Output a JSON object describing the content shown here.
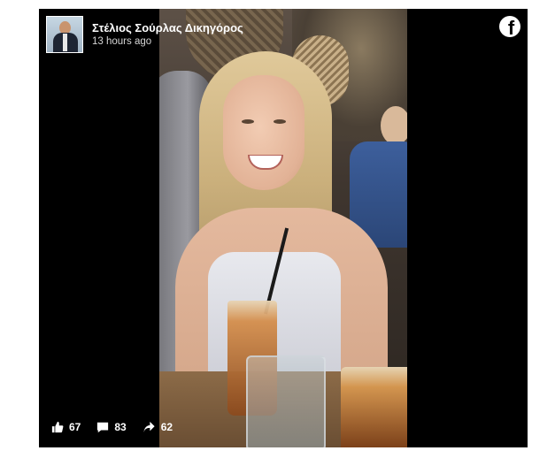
{
  "post": {
    "page_name": "Στέλιος Σούρλας Δικηγόρος",
    "timestamp": "13 hours ago",
    "brand_icon": "facebook-icon",
    "stats": {
      "likes": "67",
      "comments": "83",
      "shares": "62"
    }
  },
  "colors": {
    "background": "#000000",
    "text": "#ffffff"
  }
}
